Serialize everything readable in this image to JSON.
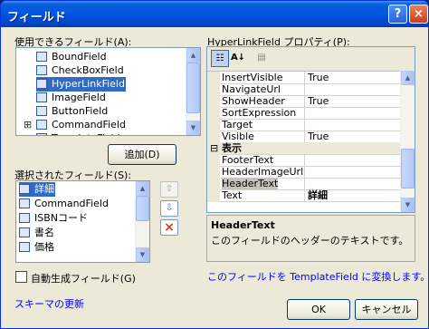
{
  "window": {
    "title": "フィールド",
    "help_icon": "?",
    "close_icon": "×"
  },
  "available": {
    "label": "使用できるフィールド(A):",
    "items": [
      {
        "label": "BoundField",
        "icon": "bound-field-icon"
      },
      {
        "label": "CheckBoxField",
        "icon": "checkbox-field-icon"
      },
      {
        "label": "HyperLinkField",
        "icon": "hyperlink-field-icon",
        "selected": true
      },
      {
        "label": "ImageField",
        "icon": "image-field-icon"
      },
      {
        "label": "ButtonField",
        "icon": "button-field-icon"
      },
      {
        "label": "CommandField",
        "icon": "command-field-icon",
        "expandable": true
      },
      {
        "label": "TemplateField",
        "icon": "template-field-icon"
      }
    ],
    "add_button": "追加(D)"
  },
  "selected_fields": {
    "label": "選択されたフィールド(S):",
    "items": [
      {
        "label": "詳細",
        "icon": "hyperlink-field-icon",
        "selected": true
      },
      {
        "label": "CommandField",
        "icon": "command-field-icon"
      },
      {
        "label": "ISBNコード",
        "icon": "bound-field-icon"
      },
      {
        "label": "書名",
        "icon": "bound-field-icon"
      },
      {
        "label": "価格",
        "icon": "bound-field-icon"
      }
    ],
    "move_up_icon": "⇧",
    "move_down_icon": "⇩",
    "delete_icon": "×"
  },
  "auto_generate": {
    "label": "自動生成フィールド(G)",
    "checked": false
  },
  "refresh_schema_link": "スキーマの更新",
  "properties": {
    "label": "HyperLinkField プロパティ(P):",
    "rows": [
      {
        "name": "InsertVisible",
        "value": "True"
      },
      {
        "name": "NavigateUrl",
        "value": ""
      },
      {
        "name": "ShowHeader",
        "value": "True"
      },
      {
        "name": "SortExpression",
        "value": ""
      },
      {
        "name": "Target",
        "value": ""
      },
      {
        "name": "Visible",
        "value": "True"
      },
      {
        "name": "表示",
        "value": "",
        "category": true,
        "toggle": "⊟"
      },
      {
        "name": "FooterText",
        "value": ""
      },
      {
        "name": "HeaderImageUrl",
        "value": ""
      },
      {
        "name": "HeaderText",
        "value": "",
        "selected": true
      },
      {
        "name": "Text",
        "value": "詳細",
        "value_bold": true
      }
    ],
    "description_title": "HeaderText",
    "description_text": "このフィールドのヘッダーのテキストです。",
    "convert_link": "このフィールドを TemplateField に変換します。"
  },
  "buttons": {
    "ok": "OK",
    "cancel": "キャンセル"
  }
}
